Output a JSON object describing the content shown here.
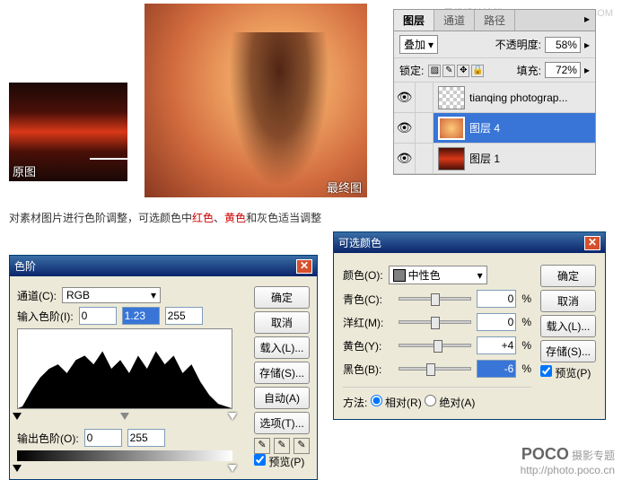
{
  "watermark": "思缘设计论坛  WWW.MISSYUAN.COM",
  "images": {
    "before_label": "原图",
    "after_label": "最终图"
  },
  "caption": {
    "pre": "对素材图片进行色阶调整，可选颜色中",
    "red": "红色",
    "mid": "、",
    "yellow": "黄色",
    "post": "和灰色适当调整"
  },
  "layers_panel": {
    "tabs": [
      "图层",
      "通道",
      "路径"
    ],
    "blend_mode": "叠加",
    "opacity_label": "不透明度:",
    "opacity_value": "58%",
    "lock_label": "锁定:",
    "fill_label": "填充:",
    "fill_value": "72%",
    "layers": [
      {
        "name": "tianqing photograp...",
        "visible": true,
        "thumb": "trans"
      },
      {
        "name": "图层 4",
        "visible": true,
        "thumb": "bokeh",
        "selected": true
      },
      {
        "name": "图层 1",
        "visible": true,
        "thumb": "red"
      }
    ]
  },
  "levels": {
    "title": "色阶",
    "channel_label": "通道(C):",
    "channel_value": "RGB",
    "input_label": "输入色阶(I):",
    "input_values": [
      "0",
      "1.23",
      "255"
    ],
    "output_label": "输出色阶(O):",
    "output_values": [
      "0",
      "255"
    ],
    "buttons": {
      "ok": "确定",
      "cancel": "取消",
      "load": "载入(L)...",
      "save": "存储(S)...",
      "auto": "自动(A)",
      "options": "选项(T)..."
    },
    "preview": "预览(P)"
  },
  "selective_color": {
    "title": "可选颜色",
    "color_label": "颜色(O):",
    "color_value": "中性色",
    "sliders": [
      {
        "label": "青色(C):",
        "value": "0",
        "pos": 50
      },
      {
        "label": "洋红(M):",
        "value": "0",
        "pos": 50
      },
      {
        "label": "黄色(Y):",
        "value": "+4",
        "pos": 54
      },
      {
        "label": "黑色(B):",
        "value": "-6",
        "pos": 44,
        "hl": true
      }
    ],
    "method_label": "方法:",
    "method_relative": "相对(R)",
    "method_absolute": "绝对(A)",
    "buttons": {
      "ok": "确定",
      "cancel": "取消",
      "load": "载入(L)...",
      "save": "存储(S)..."
    },
    "preview": "预览(P)"
  },
  "poco": {
    "brand": "POCO",
    "sub": "摄影专题",
    "url": "http://photo.poco.cn"
  }
}
